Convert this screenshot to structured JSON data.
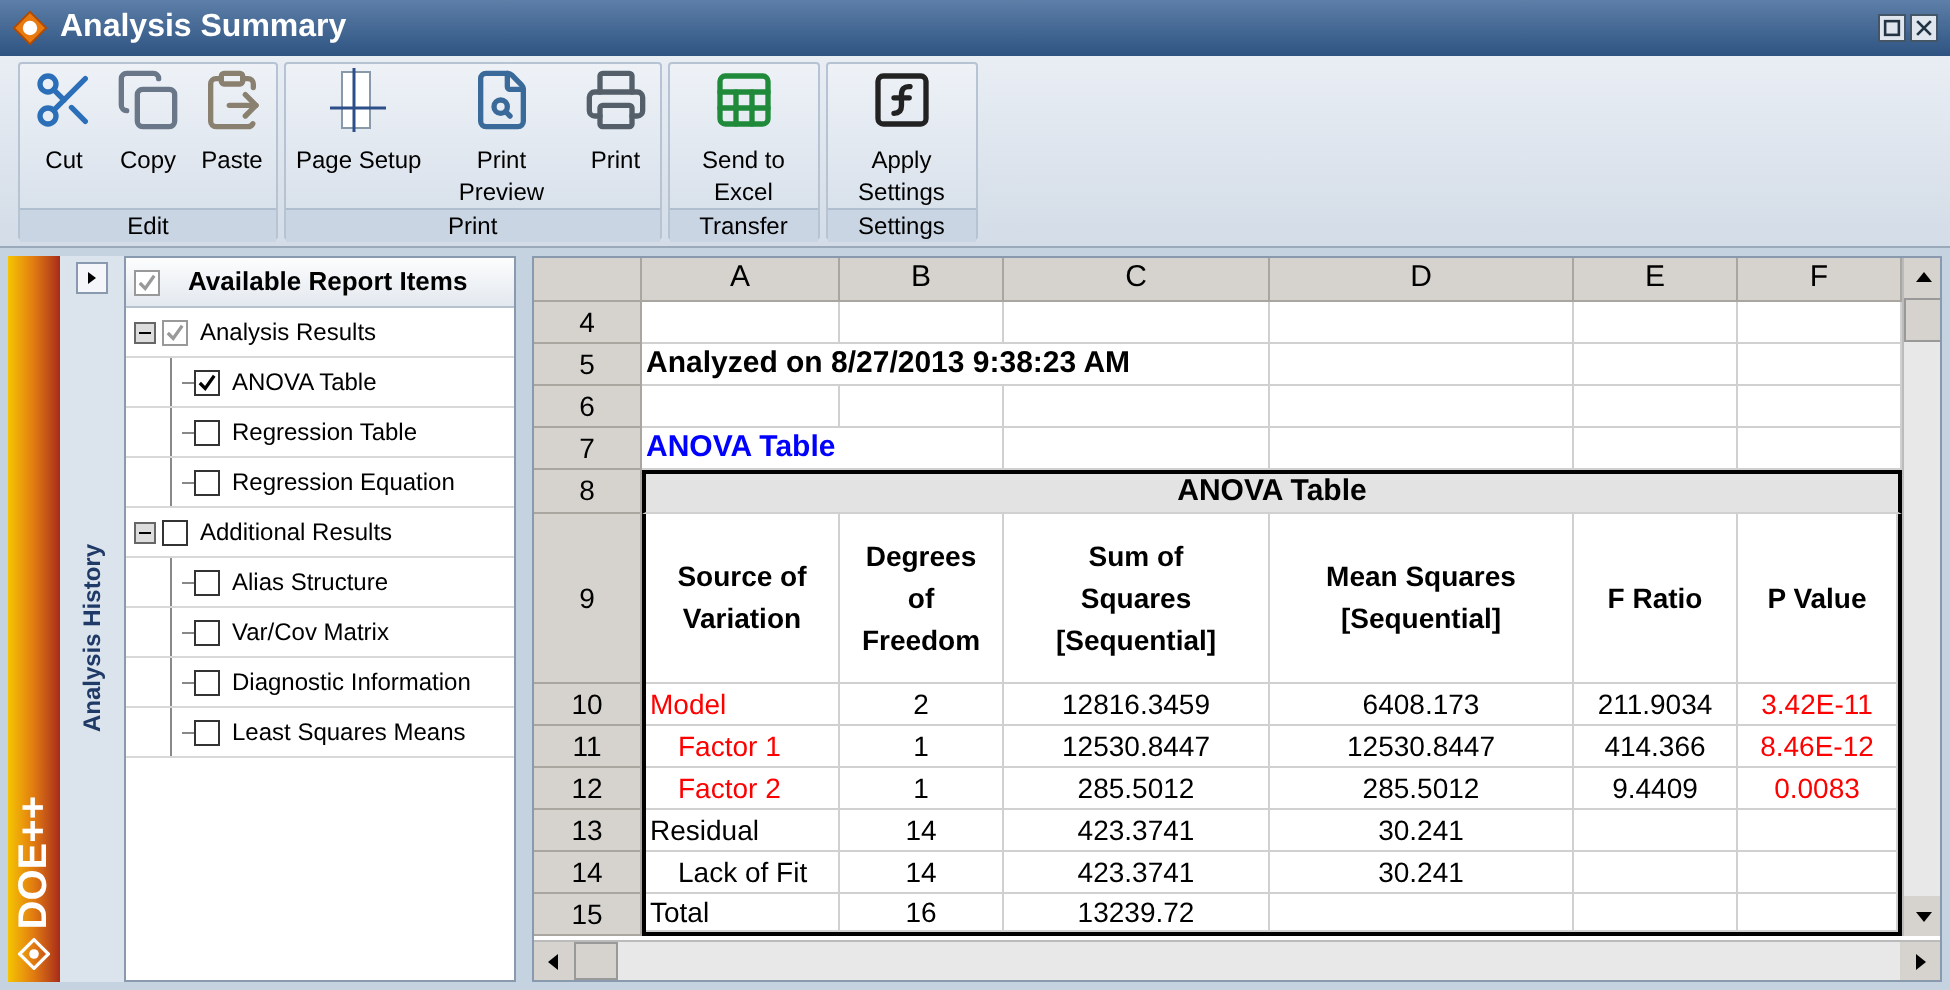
{
  "window": {
    "title": "Analysis Summary"
  },
  "ribbon": {
    "groups": [
      {
        "label": "Edit",
        "buttons": [
          {
            "label": "Cut",
            "kind": "cut"
          },
          {
            "label": "Copy",
            "kind": "copy"
          },
          {
            "label": "Paste",
            "kind": "paste"
          }
        ]
      },
      {
        "label": "Print",
        "buttons": [
          {
            "label": "Page Setup",
            "kind": "page_setup"
          },
          {
            "label": "Print Preview",
            "kind": "preview"
          },
          {
            "label": "Print",
            "kind": "print"
          }
        ]
      },
      {
        "label": "Transfer",
        "buttons": [
          {
            "label": "Send to Excel",
            "kind": "excel"
          }
        ]
      },
      {
        "label": "Settings",
        "buttons": [
          {
            "label": "Apply Settings",
            "kind": "function"
          }
        ]
      }
    ]
  },
  "sidebar": {
    "brand": "DOE++",
    "history_tab": "Analysis History"
  },
  "report_items": {
    "header": {
      "label": "Available Report Items",
      "checked": true
    },
    "items": [
      {
        "label": "Analysis Results",
        "checked": true,
        "expanded": true,
        "children": [
          {
            "label": "ANOVA Table",
            "checked": true
          },
          {
            "label": "Regression Table",
            "checked": false
          },
          {
            "label": "Regression Equation",
            "checked": false
          }
        ]
      },
      {
        "label": "Additional Results",
        "checked": false,
        "expanded": true,
        "children": [
          {
            "label": "Alias Structure",
            "checked": false
          },
          {
            "label": "Var/Cov Matrix",
            "checked": false
          },
          {
            "label": "Diagnostic Information",
            "checked": false
          },
          {
            "label": "Least Squares Means",
            "checked": false
          }
        ]
      }
    ]
  },
  "sheet": {
    "columns": [
      "A",
      "B",
      "C",
      "D",
      "E",
      "F"
    ],
    "rows": [
      {
        "number": "4",
        "kind": "blank"
      },
      {
        "number": "5",
        "kind": "note",
        "text": "Analyzed on 8/27/2013 9:38:23 AM"
      },
      {
        "number": "6",
        "kind": "blank"
      },
      {
        "number": "7",
        "kind": "heading",
        "text": "ANOVA Table"
      },
      {
        "number": "8",
        "kind": "table_title",
        "text": "ANOVA Table"
      },
      {
        "number": "9",
        "kind": "table_header",
        "cells": [
          "Source of Variation",
          "Degrees of Freedom",
          "Sum of Squares [Sequential]",
          "Mean Squares [Sequential]",
          "F Ratio",
          "P Value"
        ]
      }
    ],
    "anova": [
      {
        "number": "10",
        "source": "Model",
        "df": "2",
        "ss": "12816.3459",
        "ms": "6408.173",
        "f_ratio": "211.9034",
        "p_value": "3.42E-11",
        "significant": true,
        "children": [
          {
            "number": "11",
            "source": "Factor 1",
            "df": "1",
            "ss": "12530.8447",
            "ms": "12530.8447",
            "f_ratio": "414.366",
            "p_value": "8.46E-12",
            "significant": true
          },
          {
            "number": "12",
            "source": "Factor 2",
            "df": "1",
            "ss": "285.5012",
            "ms": "285.5012",
            "f_ratio": "9.4409",
            "p_value": "0.0083",
            "significant": true
          }
        ]
      },
      {
        "number": "13",
        "source": "Residual",
        "df": "14",
        "ss": "423.3741",
        "ms": "30.241",
        "significant": false,
        "children": [
          {
            "number": "14",
            "source": "Lack of Fit",
            "df": "14",
            "ss": "423.3741",
            "ms": "30.241",
            "significant": false
          }
        ]
      },
      {
        "number": "15",
        "source": "Total",
        "df": "16",
        "ss": "13239.72",
        "significant": false
      }
    ]
  }
}
